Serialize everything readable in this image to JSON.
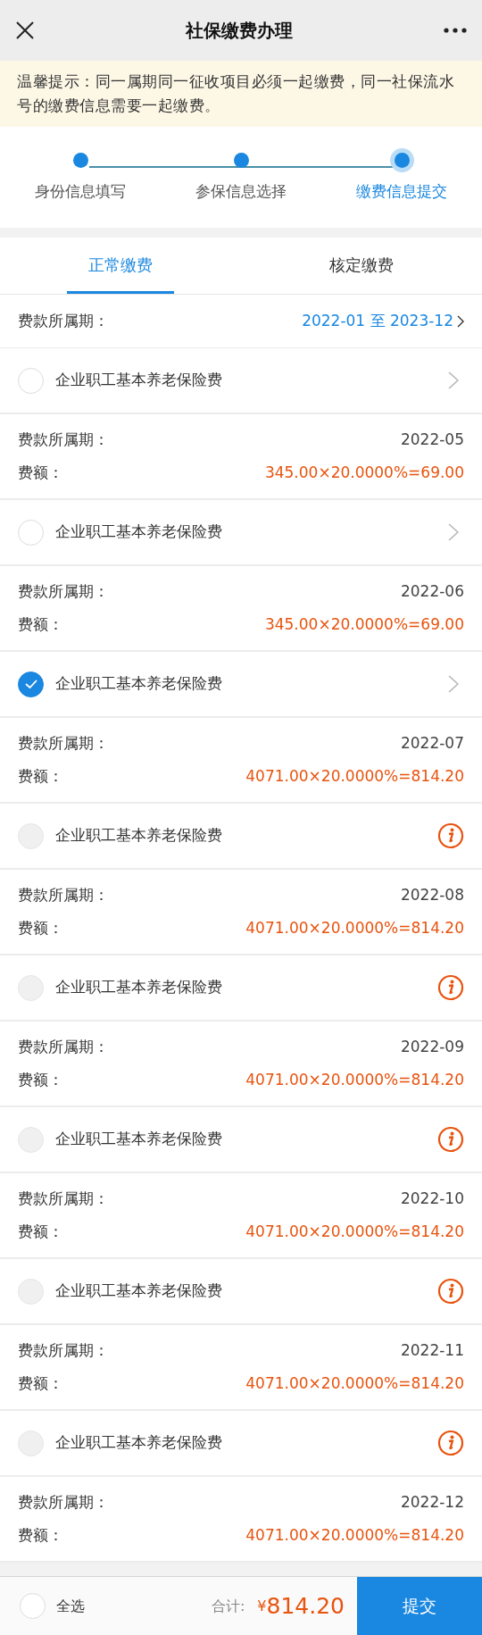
{
  "header": {
    "title": "社保缴费办理"
  },
  "notice": "温馨提示：同一属期同一征收项目必须一起缴费，同一社保流水号的缴费信息需要一起缴费。",
  "steps": [
    {
      "label": "身份信息填写",
      "selected": false
    },
    {
      "label": "参保信息选择",
      "selected": false
    },
    {
      "label": "缴费信息提交",
      "selected": true
    }
  ],
  "tabs": [
    {
      "label": "正常缴费",
      "selected": true
    },
    {
      "label": "核定缴费",
      "selected": false
    }
  ],
  "period_filter": {
    "label": "费款所属期：",
    "value": "2022-01 至 2023-12"
  },
  "items": [
    {
      "name": "企业职工基本养老保险费",
      "checked": false,
      "disabled": false,
      "period_label": "费款所属期：",
      "period": "2022-05",
      "amount_label": "费额：",
      "amount": "345.00×20.0000%=69.00"
    },
    {
      "name": "企业职工基本养老保险费",
      "checked": false,
      "disabled": false,
      "period_label": "费款所属期：",
      "period": "2022-06",
      "amount_label": "费额：",
      "amount": "345.00×20.0000%=69.00"
    },
    {
      "name": "企业职工基本养老保险费",
      "checked": true,
      "disabled": false,
      "period_label": "费款所属期：",
      "period": "2022-07",
      "amount_label": "费额：",
      "amount": "4071.00×20.0000%=814.20"
    },
    {
      "name": "企业职工基本养老保险费",
      "checked": false,
      "disabled": true,
      "period_label": "费款所属期：",
      "period": "2022-08",
      "amount_label": "费额：",
      "amount": "4071.00×20.0000%=814.20"
    },
    {
      "name": "企业职工基本养老保险费",
      "checked": false,
      "disabled": true,
      "period_label": "费款所属期：",
      "period": "2022-09",
      "amount_label": "费额：",
      "amount": "4071.00×20.0000%=814.20"
    },
    {
      "name": "企业职工基本养老保险费",
      "checked": false,
      "disabled": true,
      "period_label": "费款所属期：",
      "period": "2022-10",
      "amount_label": "费额：",
      "amount": "4071.00×20.0000%=814.20"
    },
    {
      "name": "企业职工基本养老保险费",
      "checked": false,
      "disabled": true,
      "period_label": "费款所属期：",
      "period": "2022-11",
      "amount_label": "费额：",
      "amount": "4071.00×20.0000%=814.20"
    },
    {
      "name": "企业职工基本养老保险费",
      "checked": false,
      "disabled": true,
      "period_label": "费款所属期：",
      "period": "2022-12",
      "amount_label": "费额：",
      "amount": "4071.00×20.0000%=814.20"
    }
  ],
  "footer": {
    "select_all": {
      "label": "全选",
      "checked": false
    },
    "total_label": "合计:",
    "currency": "¥",
    "total": "814.20",
    "submit": "提交"
  }
}
